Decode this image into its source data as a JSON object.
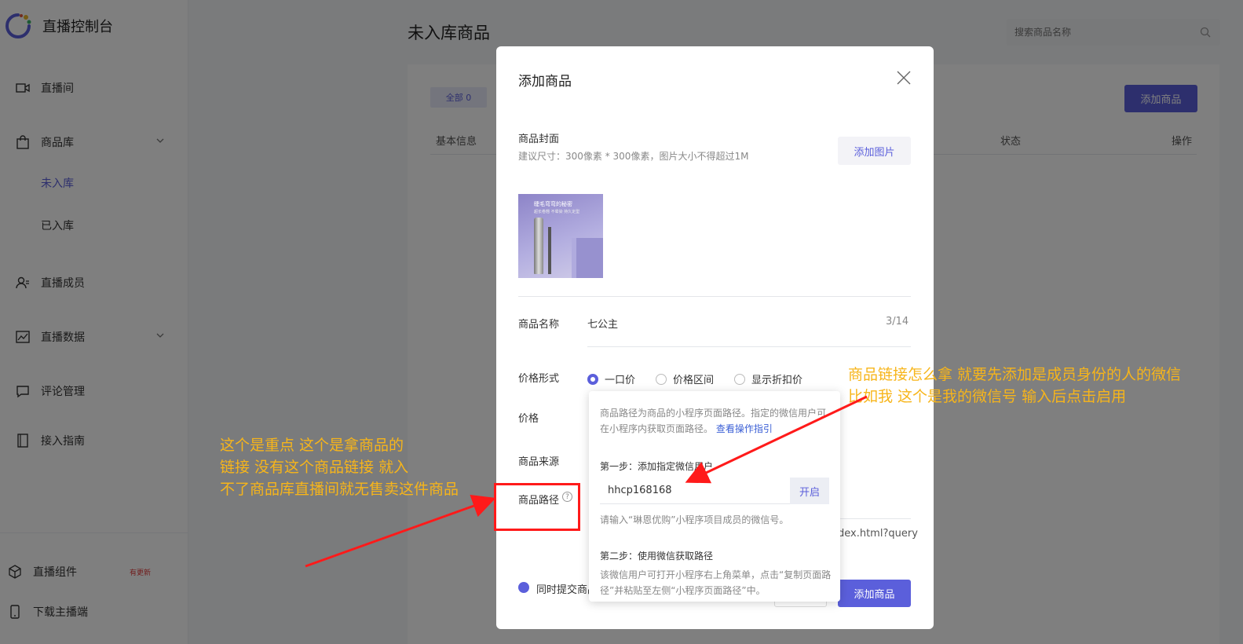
{
  "app": {
    "title": "直播控制台"
  },
  "sidebar": {
    "items": [
      {
        "label": "直播间",
        "icon": "video-icon"
      },
      {
        "label": "商品库",
        "icon": "bag-icon"
      },
      {
        "label": "直播成员",
        "icon": "members-icon"
      },
      {
        "label": "直播数据",
        "icon": "chart-icon"
      },
      {
        "label": "评论管理",
        "icon": "comment-icon"
      },
      {
        "label": "接入指南",
        "icon": "book-icon"
      }
    ],
    "sub_items": [
      {
        "label": "未入库",
        "active": true
      },
      {
        "label": "已入库",
        "active": false
      }
    ],
    "bottom": [
      {
        "label": "直播组件",
        "icon": "cube-icon",
        "badge": "有更新"
      },
      {
        "label": "下载主播端",
        "icon": "phone-icon"
      }
    ]
  },
  "main": {
    "page_title": "未入库商品",
    "search_placeholder": "搜索商品名称",
    "tab_all": "全部 0",
    "add_button": "添加商品",
    "columns": [
      "基本信息",
      "状态",
      "操作"
    ]
  },
  "modal": {
    "title": "添加商品",
    "cover_label": "商品封面",
    "cover_hint": "建议尺寸：300像素 * 300像素，图片大小不得超过1M",
    "add_image_button": "添加图片",
    "cover_text_1": "睫毛弯弯的秘密",
    "cover_text_2": "超长卷翘 不晕染 持久定型",
    "name_label": "商品名称",
    "name_value": "七公主",
    "name_count": "3/14",
    "price_type_label": "价格形式",
    "price_options": [
      "一口价",
      "价格区间",
      "显示折扣价"
    ],
    "price_label": "价格",
    "source_label": "商品来源",
    "path_label": "商品路径",
    "help_mark": "?",
    "path_value_tail": "dex.html?query",
    "sync_checkbox_label": "同时提交商品",
    "submit_button": "添加商品"
  },
  "popover": {
    "desc": "商品路径为商品的小程序页面路径。指定的微信用户可在小程序内获取页面路径。",
    "guide_link": "查看操作指引",
    "step1_title": "第一步：添加指定微信用户",
    "wechat_input_value": "hhcp168168",
    "open_button": "开启",
    "step1_hint": "请输入“琳恩优购”小程序项目成员的微信号。",
    "step2_title": "第二步：使用微信获取路径",
    "step2_desc": "该微信用户可打开小程序右上角菜单，点击“复制页面路径”并粘贴至左侧“小程序页面路径”中。"
  },
  "annotations": {
    "left_note": "这个是重点  这个是拿商品的\n链接 没有这个商品链接 就入\n不了商品库直播间就无售卖这件商品",
    "right_note": "商品链接怎么拿  就要先添加是成员身份的人的微信\n比如我  这个是我的微信号 输入后点击启用",
    "note_color": "#f7b51a",
    "arrow_color": "#ff1a1a"
  },
  "colors": {
    "accent": "#5b5fdb",
    "link": "#3c60d6"
  }
}
